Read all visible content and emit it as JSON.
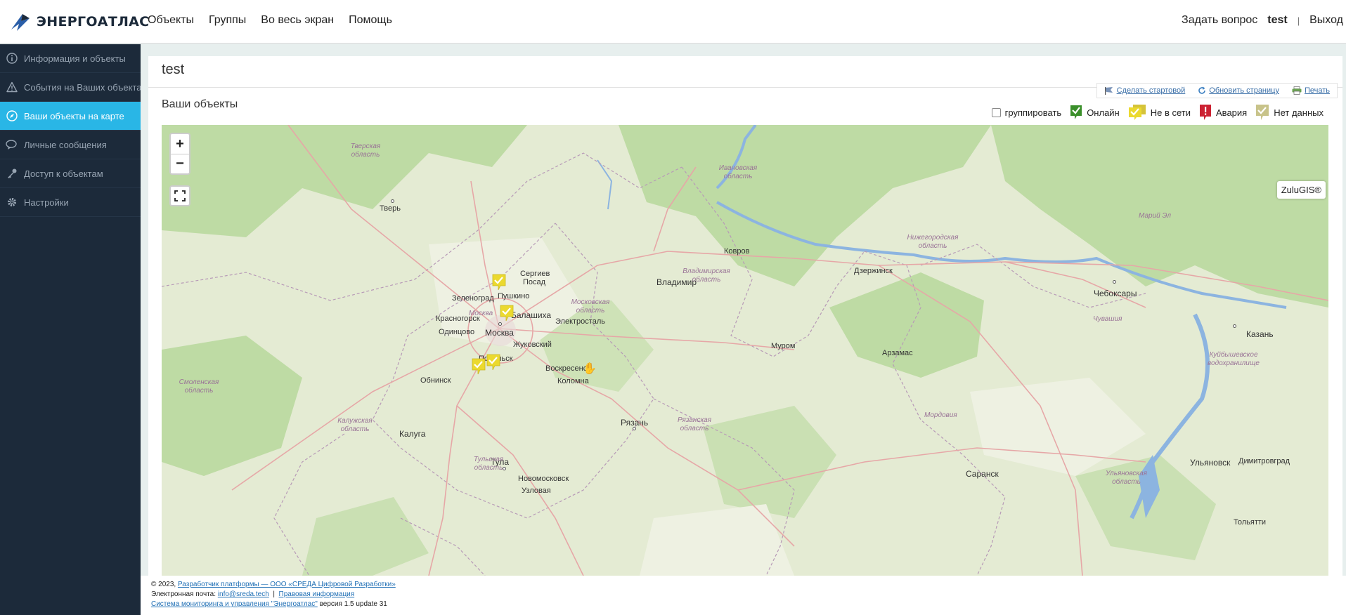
{
  "app": {
    "logo_text": "ЭНЕРГОАТЛАС"
  },
  "topnav": {
    "items": [
      "Объекты",
      "Группы",
      "Во весь экран",
      "Помощь"
    ],
    "ask": "Задать вопрос",
    "user": "test",
    "separator": "|",
    "logout": "Выход"
  },
  "sidebar": {
    "items": [
      {
        "label": "Информация и объекты",
        "icon": "info-icon"
      },
      {
        "label": "События на Ваших объектах",
        "icon": "warning-icon"
      },
      {
        "label": "Ваши объекты на карте",
        "icon": "compass-icon",
        "active": true
      },
      {
        "label": "Личные сообщения",
        "icon": "chat-icon"
      },
      {
        "label": "Доступ к объектам",
        "icon": "key-icon"
      },
      {
        "label": "Настройки",
        "icon": "gear-icon"
      }
    ]
  },
  "panel": {
    "title": "test",
    "section_title": "Ваши объекты",
    "toolbar": {
      "make_start": "Сделать стартовой",
      "refresh": "Обновить страницу",
      "print": "Печать"
    }
  },
  "legend": {
    "group_label": "группировать",
    "online": "Онлайн",
    "offline": "Не в сети",
    "alarm": "Авария",
    "nodata": "Нет данных",
    "colors": {
      "online": "#3a8f2a",
      "offline": "#e8d42a",
      "alarm": "#cc2233",
      "nodata": "#c8c38a"
    }
  },
  "map": {
    "zoom_in": "+",
    "zoom_out": "−",
    "attribution": "ZuluGIS®",
    "cities": [
      "Тверь",
      "Ковров",
      "Владимир",
      "Дзержинск",
      "Чебоксары",
      "Казань",
      "Сергиев Посад",
      "Пушкино",
      "Зеленоград",
      "Балашиха",
      "Красногорск",
      "Москва",
      "Электросталь",
      "Одинцово",
      "Жуковский",
      "Подольск",
      "Муром",
      "Арзамас",
      "Воскресенск",
      "Обнинск",
      "Коломна",
      "Рязань",
      "Калуга",
      "Тула",
      "Новомосковск",
      "Узловая",
      "Саранск",
      "Ульяновск",
      "Димитровград",
      "Тольятти"
    ],
    "regions": [
      "Тверская область",
      "Ивановская область",
      "Марий Эл",
      "Нижегородская область",
      "Владимирская область",
      "Московская область",
      "Москва",
      "Чувашия",
      "Смоленская область",
      "Калужская область",
      "Рязанская область",
      "Мордовия",
      "Куйбышевское водохранилище",
      "Тульская область",
      "Ульяновская область"
    ]
  },
  "footer": {
    "copyright": "© 2023,",
    "developer_link": "Разработчик платформы — ООО «СРЕДА Цифровой Разработки»",
    "email_label": "Электронная почта:",
    "email": "info@sreda.tech",
    "divider": "|",
    "legal_link": "Правовая информация",
    "system_link": "Система мониторинга и управления \"Энергоатлас\"",
    "version": "версия 1.5 update 31"
  }
}
